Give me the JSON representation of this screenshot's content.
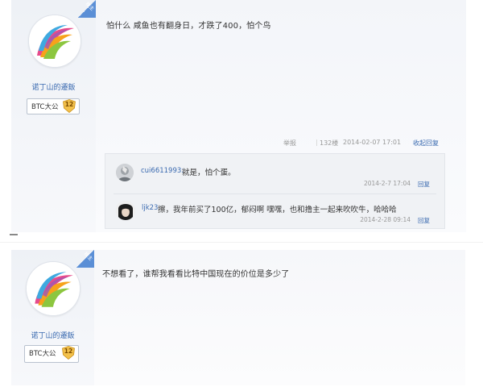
{
  "posts": [
    {
      "badge": "楼主",
      "username": "诺丁山的遷鈑",
      "level_title": "BTC大公",
      "level_number": "12",
      "text": "怕什么 咸鱼也有翻身日，才跌了400，怕个鸟",
      "meta": {
        "report": "举报",
        "count": "132楼",
        "time": "2014-02-07 17:01",
        "reply": "收起回复"
      },
      "replies": [
        {
          "user": "cui6611993:",
          "text": "就是，怕个蛋。",
          "time": "2014-2-7 17:04",
          "reply": "回复"
        },
        {
          "user": "ljk23:",
          "text": "擦，我年前买了100亿，郁闷啊 嘿嘿，也和撸主一起来吹吹牛，哈哈哈",
          "time": "2014-2-28 09:14",
          "reply": "回复"
        }
      ]
    },
    {
      "badge": "楼主",
      "username": "诺丁山的遷鈑",
      "level_title": "BTC大公",
      "level_number": "12",
      "text": "不想看了，谁帮我看看比特中国现在的价位是多少了"
    }
  ],
  "icons": {
    "avatar": "colorful-swirl-avatar",
    "level": "shield-level-icon",
    "reply_avatar_1": "user-avatar-gray",
    "reply_avatar_2": "user-avatar-dark"
  },
  "colors": {
    "link": "#3a6ab0",
    "badge": "#5b8fd6",
    "meta": "#999999"
  }
}
